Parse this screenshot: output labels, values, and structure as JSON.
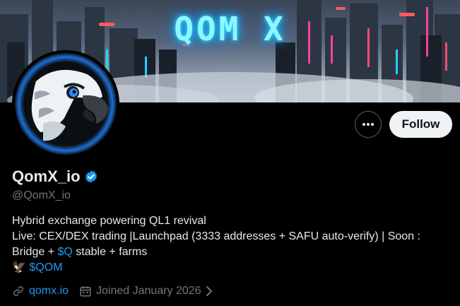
{
  "banner": {
    "title": "QOM X"
  },
  "profile": {
    "display_name": "QomX_io",
    "handle": "@QomX_io",
    "verified": true,
    "follow_label": "Follow",
    "more_label": "•••",
    "bio": {
      "line1": "Hybrid exchange powering QL1 revival",
      "line2": "Live: CEX/DEX trading |Launchpad (3333 addresses + SAFU auto-verify) | Soon :",
      "line3_prefix": "Bridge + ",
      "line3_link": "$Q",
      "line3_suffix": " stable + farms",
      "line4_emoji": "🦅",
      "line4_link": "$QOM"
    },
    "website": "qomx.io",
    "joined": "Joined January 2026"
  },
  "colors": {
    "background": "#000000",
    "text": "#e7e9ea",
    "secondary": "#71767b",
    "link": "#1d9bf0",
    "follow_bg": "#eff3f4"
  },
  "icons": [
    "more-icon",
    "verified-badge-icon",
    "link-icon",
    "calendar-icon",
    "chevron-right-icon",
    "eagle-avatar"
  ]
}
